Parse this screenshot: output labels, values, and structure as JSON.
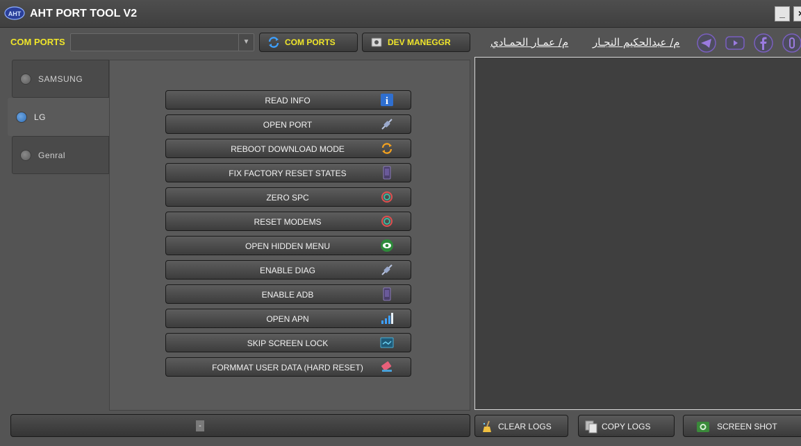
{
  "window": {
    "title": "AHT PORT TOOL V2",
    "logo_text": "AHT",
    "minimize": "_",
    "close": "×"
  },
  "toolbar": {
    "com_ports_label": "COM PORTS",
    "com_port_selected": "",
    "com_ports_button": "COM PORTS",
    "dev_manager_button": "DEV MANEGGR"
  },
  "credits": {
    "name1": "م/ عمـار الحمـادي",
    "name2": "م/ عبدالحكيم النجـار"
  },
  "social": [
    "telegram-icon",
    "youtube-icon",
    "facebook-icon",
    "messenger-icon"
  ],
  "tabs": [
    {
      "label": "SAMSUNG",
      "active": false
    },
    {
      "label": "LG",
      "active": true
    },
    {
      "label": "Genral",
      "active": false
    }
  ],
  "actions": [
    {
      "label": "READ INFO",
      "icon": "info-icon"
    },
    {
      "label": "OPEN PORT",
      "icon": "plug-icon"
    },
    {
      "label": "REBOOT DOWNLOAD MODE",
      "icon": "refresh-icon"
    },
    {
      "label": "FIX FACTORY RESET STATES",
      "icon": "phone-icon"
    },
    {
      "label": "ZERO  SPC",
      "icon": "reset-icon"
    },
    {
      "label": "RESET MODEMS",
      "icon": "reset-icon"
    },
    {
      "label": "OPEN HIDDEN MENU",
      "icon": "eye-icon"
    },
    {
      "label": "ENABLE  DIAG",
      "icon": "plug-icon"
    },
    {
      "label": "ENABLE ADB",
      "icon": "phone-icon"
    },
    {
      "label": "OPEN  APN",
      "icon": "signal-icon"
    },
    {
      "label": "SKIP SCREEN LOCK",
      "icon": "lock-screen-icon"
    },
    {
      "label": "FORMMAT USER  DATA  (HARD RESET)",
      "icon": "eraser-icon"
    }
  ],
  "status": {
    "text": "-"
  },
  "bottom": {
    "clear_logs": "CLEAR LOGS",
    "copy_logs": "COPY LOGS",
    "screen_shot": "SCREEN SHOT"
  },
  "colors": {
    "accent_yellow": "#f0e62a",
    "background": "#545454",
    "log_background": "#3f3f3f",
    "radio_active": "#2f6fb9"
  }
}
